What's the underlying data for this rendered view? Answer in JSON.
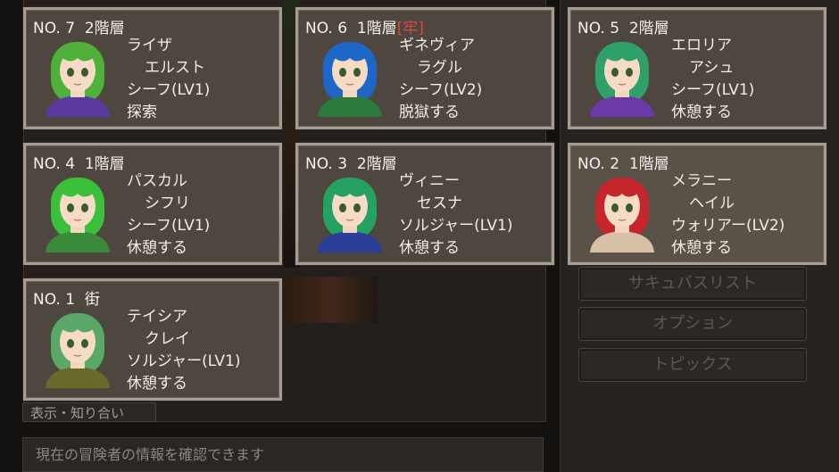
{
  "adventurers": [
    {
      "no": "NO. 7",
      "floor": "2階層",
      "jail": "",
      "first": "ライザ",
      "last": "エルスト",
      "job": "シーフ(LV1)",
      "status": "探索",
      "hair": "#4fb03a",
      "outfit": "#5a3aa0"
    },
    {
      "no": "NO. 6",
      "floor": "1階層",
      "jail": "[牢]",
      "first": "ギネヴィア",
      "last": "ラグル",
      "job": "シーフ(LV2)",
      "status": "脱獄する",
      "hair": "#1e66c8",
      "outfit": "#2c7a3a"
    },
    {
      "no": "NO. 5",
      "floor": "2階層",
      "jail": "",
      "first": "エロリア",
      "last": "アシュ",
      "job": "シーフ(LV1)",
      "status": "休憩する",
      "hair": "#2fa06a",
      "outfit": "#6a3aa8"
    },
    {
      "no": "NO. 4",
      "floor": "1階層",
      "jail": "",
      "first": "パスカル",
      "last": "シフリ",
      "job": "シーフ(LV1)",
      "status": "休憩する",
      "hair": "#3cbf3a",
      "outfit": "#3a8a3a"
    },
    {
      "no": "NO. 3",
      "floor": "2階層",
      "jail": "",
      "first": "ヴィニー",
      "last": "セスナ",
      "job": "ソルジャー(LV1)",
      "status": "休憩する",
      "hair": "#27a064",
      "outfit": "#2a3f9a"
    },
    {
      "no": "NO. 2",
      "floor": "1階層",
      "jail": "",
      "first": "メラニー",
      "last": "ヘイル",
      "job": "ウォリアー(LV2)",
      "status": "休憩する",
      "hair": "#c4262c",
      "outfit": "#d8c0a8"
    },
    {
      "no": "NO. 1",
      "floor": "街",
      "jail": "",
      "first": "テイシア",
      "last": "クレイ",
      "job": "ソルジャー(LV1)",
      "status": "休憩する",
      "hair": "#5aa868",
      "outfit": "#6a6a2a"
    }
  ],
  "menu": {
    "succubus_list": "サキュバスリスト",
    "options": "オプション",
    "topics": "トピックス"
  },
  "view_tab": "表示・知り合い",
  "help_text": "現在の冒険者の情報を確認できます"
}
